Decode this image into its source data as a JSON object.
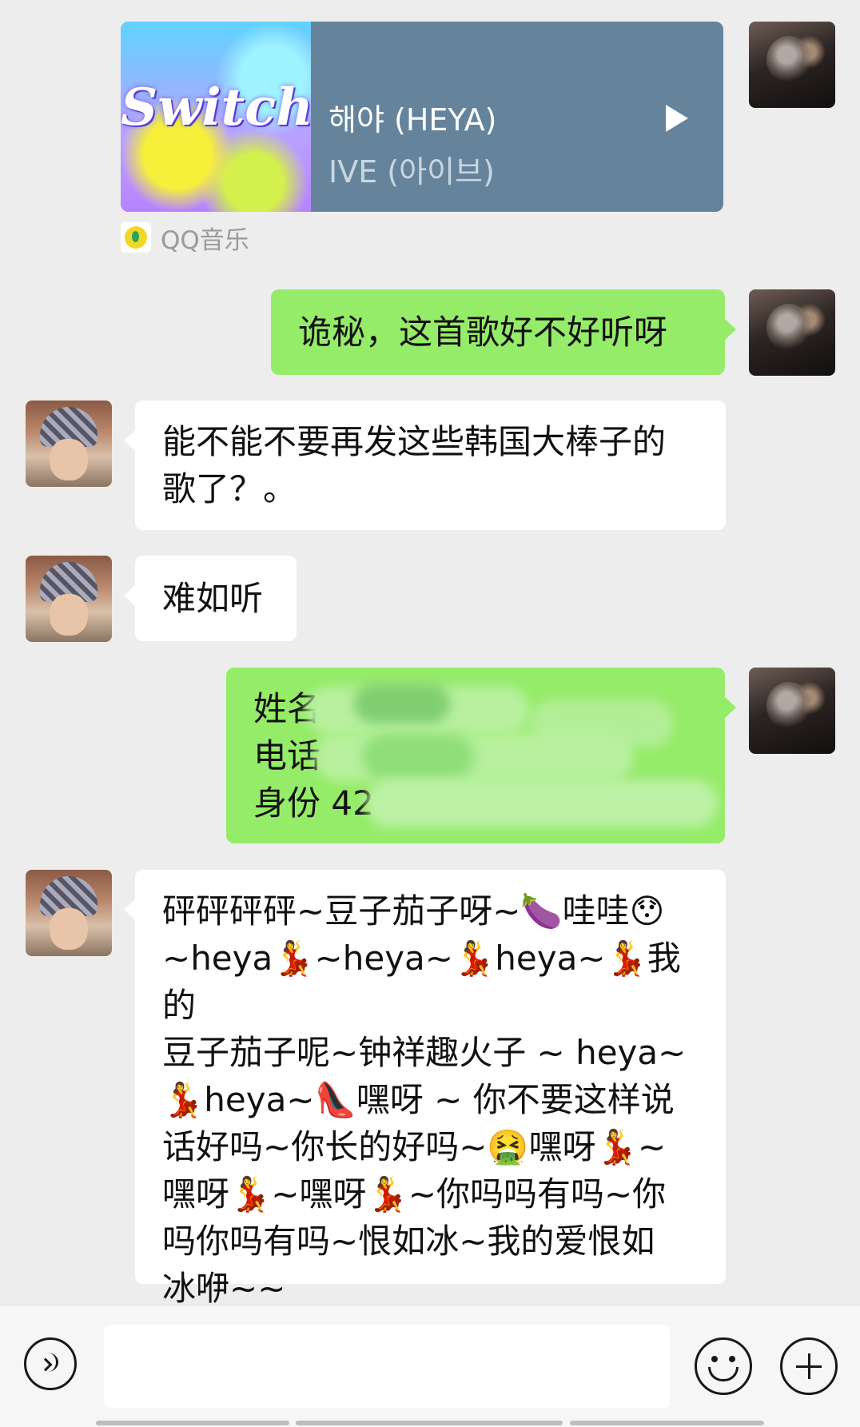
{
  "music_card": {
    "cover_text": "Switch",
    "title": "해야 (HEYA)",
    "artist": "IVE (아이브)",
    "source": "QQ音乐"
  },
  "messages": [
    {
      "side": "me",
      "lines": [
        "诡秘，这首歌好不好听呀"
      ]
    },
    {
      "side": "her",
      "lines": [
        "能不能不要再发这些韩国大棒子的",
        "歌了？。"
      ]
    },
    {
      "side": "her",
      "lines": [
        "难如听"
      ]
    },
    {
      "side": "me",
      "lines": [
        "姓名",
        "电话",
        "身份 42"
      ]
    },
    {
      "side": "her",
      "lines": [
        "砰砰砰砰~豆子茄子呀~🍆哇哇😯",
        "~heya💃~heya~💃heya~💃我的",
        "豆子茄子呢~钟祥趣火子 ~ heya~",
        "💃heya~👠嘿呀 ~ 你不要这样说",
        "话好吗~你长的好吗~🤮嘿呀💃~",
        "嘿呀💃~嘿呀💃~你吗吗有吗~你",
        "吗你吗有吗~恨如冰~我的爱恨如",
        "冰咿~~"
      ]
    }
  ],
  "colors": {
    "background": "#ededed",
    "my_bubble": "#95ec69",
    "her_bubble": "#ffffff",
    "music_card": "#65849b"
  },
  "icons": [
    "voice-icon",
    "emoji-icon",
    "plus-icon",
    "play-icon"
  ]
}
